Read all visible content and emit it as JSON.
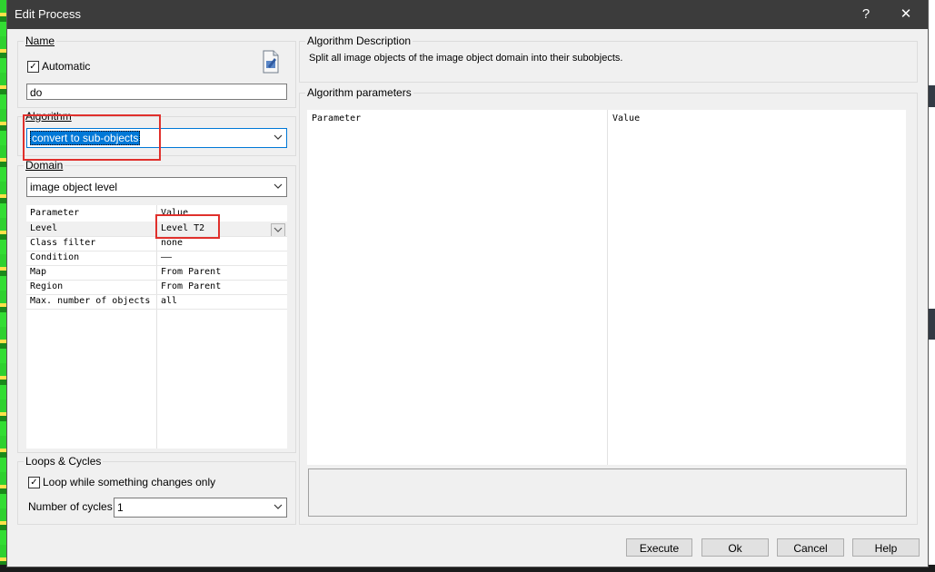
{
  "window": {
    "title": "Edit Process",
    "help_glyph": "?",
    "close_glyph": "✕"
  },
  "name_group": {
    "label": "Name",
    "automatic_label": "Automatic",
    "automatic_checked": true,
    "name_value": "do"
  },
  "algorithm_group": {
    "label": "Algorithm",
    "selected": "convert to sub-objects"
  },
  "domain_group": {
    "label": "Domain",
    "selected": "image object level",
    "table": {
      "headers": [
        "Parameter",
        "Value"
      ],
      "rows": [
        [
          "Level",
          "Level T2"
        ],
        [
          "Class filter",
          "none"
        ],
        [
          "Condition",
          "——"
        ],
        [
          "Map",
          "From Parent"
        ],
        [
          "Region",
          "From Parent"
        ],
        [
          "Max. number of objects",
          "all"
        ]
      ]
    }
  },
  "loops_group": {
    "label": "Loops & Cycles",
    "loop_label": "Loop while something changes only",
    "loop_checked": true,
    "cycles_label": "Number of cycles",
    "cycles_value": "1"
  },
  "description_group": {
    "label": "Algorithm Description",
    "text": "Split all image objects of the image object domain into their subobjects."
  },
  "parameters_group": {
    "label": "Algorithm parameters",
    "headers": [
      "Parameter",
      "Value"
    ]
  },
  "buttons": {
    "execute": "Execute",
    "ok": "Ok",
    "cancel": "Cancel",
    "help": "Help"
  },
  "colors": {
    "titlebar": "#3c3c3c",
    "selection": "#0078d7",
    "highlight_box": "#e0302c"
  },
  "icons": {
    "edit_icon": "document-edit-icon",
    "dropdown": "chevron-down-icon"
  }
}
